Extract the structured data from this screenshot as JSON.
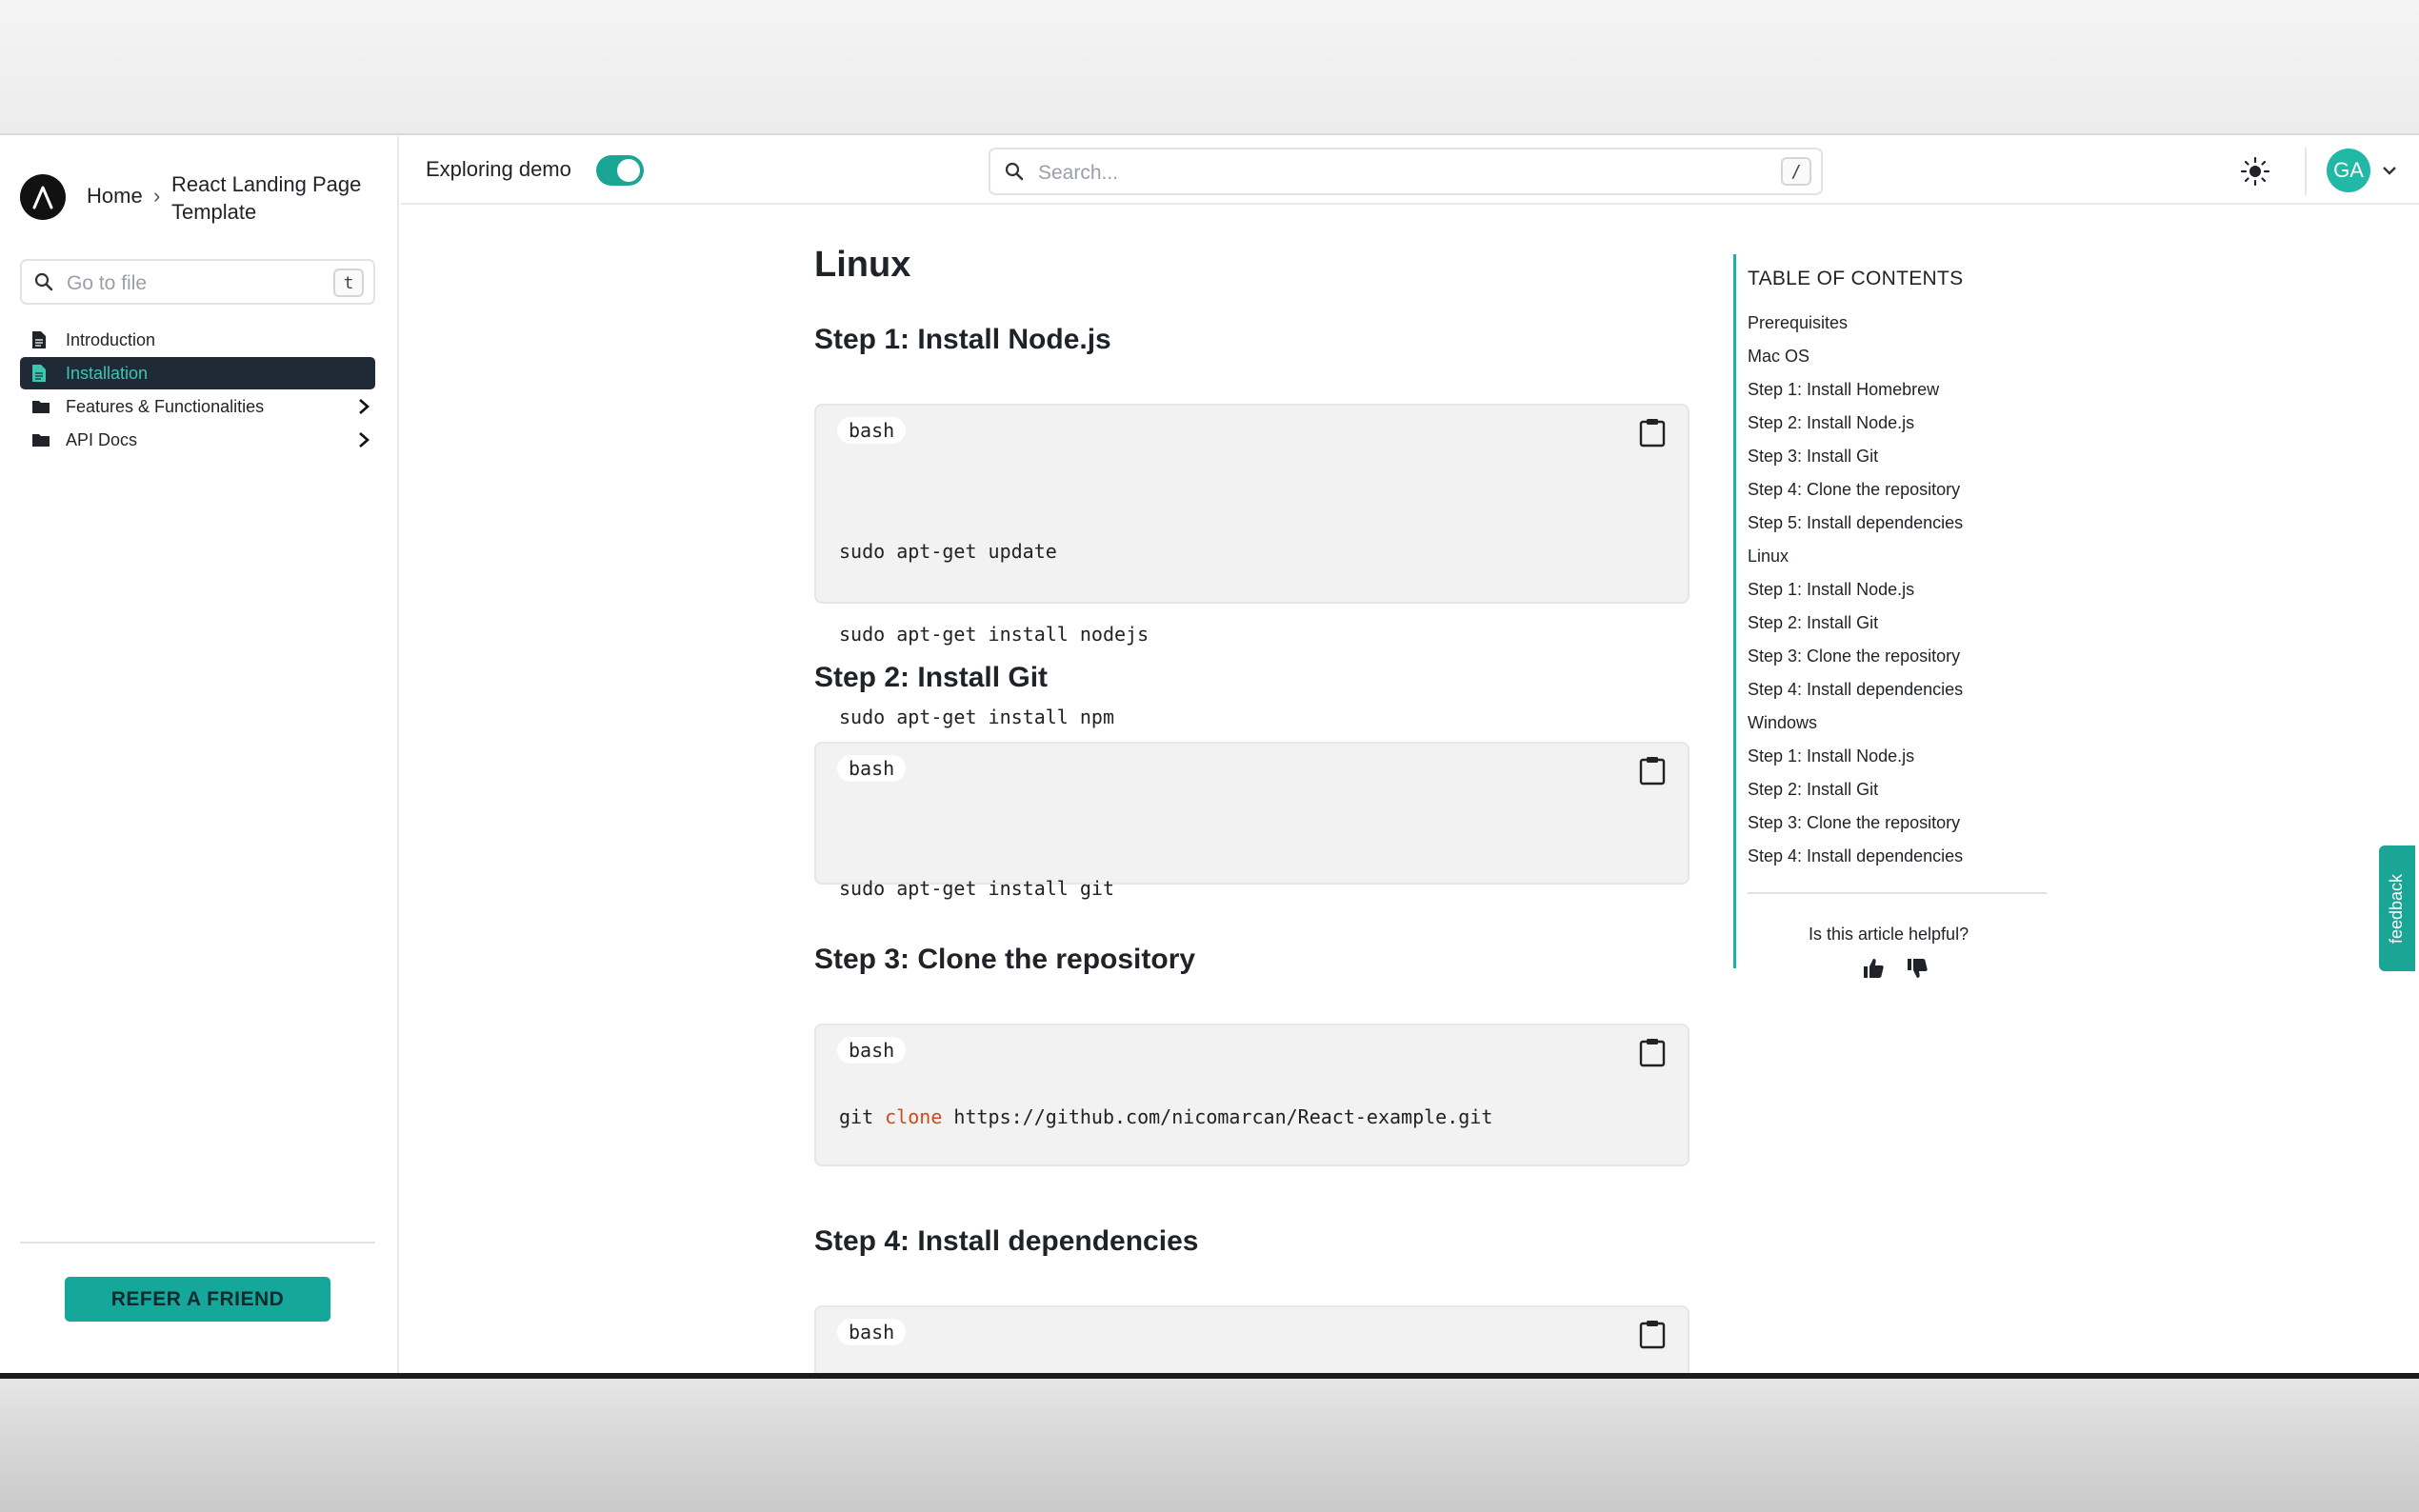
{
  "sidebar": {
    "breadcrumb": {
      "home": "Home",
      "separator": "›",
      "current": "React Landing Page Template"
    },
    "goto": {
      "placeholder": "Go to file",
      "shortcut": "t"
    },
    "items": [
      {
        "label": "Introduction",
        "icon": "file-icon",
        "active": false,
        "expandable": false
      },
      {
        "label": "Installation",
        "icon": "file-icon",
        "active": true,
        "expandable": false
      },
      {
        "label": "Features & Functionalities",
        "icon": "folder-icon",
        "active": false,
        "expandable": true
      },
      {
        "label": "API Docs",
        "icon": "folder-icon",
        "active": false,
        "expandable": true
      }
    ],
    "refer_label": "REFER A FRIEND"
  },
  "header": {
    "demo_label": "Exploring demo",
    "demo_enabled": true,
    "search_placeholder": "Search...",
    "search_shortcut": "/",
    "avatar_initials": "GA"
  },
  "article": {
    "title": "Linux",
    "steps": [
      {
        "heading": "Step 1: Install Node.js",
        "lang": "bash",
        "lines": [
          "sudo apt-get update",
          "sudo apt-get install nodejs",
          "sudo apt-get install npm"
        ]
      },
      {
        "heading": "Step 2: Install Git",
        "lang": "bash",
        "lines": [
          "sudo apt-get install git"
        ]
      },
      {
        "heading": "Step 3: Clone the repository",
        "lang": "bash",
        "line_parts": [
          "git ",
          "clone",
          " https://github.com/nicomarcan/React-example.git"
        ]
      },
      {
        "heading": "Step 4: Install dependencies",
        "lang": "bash"
      }
    ]
  },
  "toc": {
    "title": "TABLE OF CONTENTS",
    "items": [
      "Prerequisites",
      "Mac OS",
      "Step 1: Install Homebrew",
      "Step 2: Install Node.js",
      "Step 3: Install Git",
      "Step 4: Clone the repository",
      "Step 5: Install dependencies",
      "Linux",
      "Step 1: Install Node.js",
      "Step 2: Install Git",
      "Step 3: Clone the repository",
      "Step 4: Install dependencies",
      "Windows",
      "Step 1: Install Node.js",
      "Step 2: Install Git",
      "Step 3: Clone the repository",
      "Step 4: Install dependencies"
    ],
    "helpful_prompt": "Is this article helpful?"
  },
  "feedback_label": "feedback",
  "colors": {
    "accent": "#1aa595",
    "active_nav_bg": "#1f2a36",
    "active_nav_text": "#3cc5b0",
    "keyword": "#d14a1d"
  }
}
